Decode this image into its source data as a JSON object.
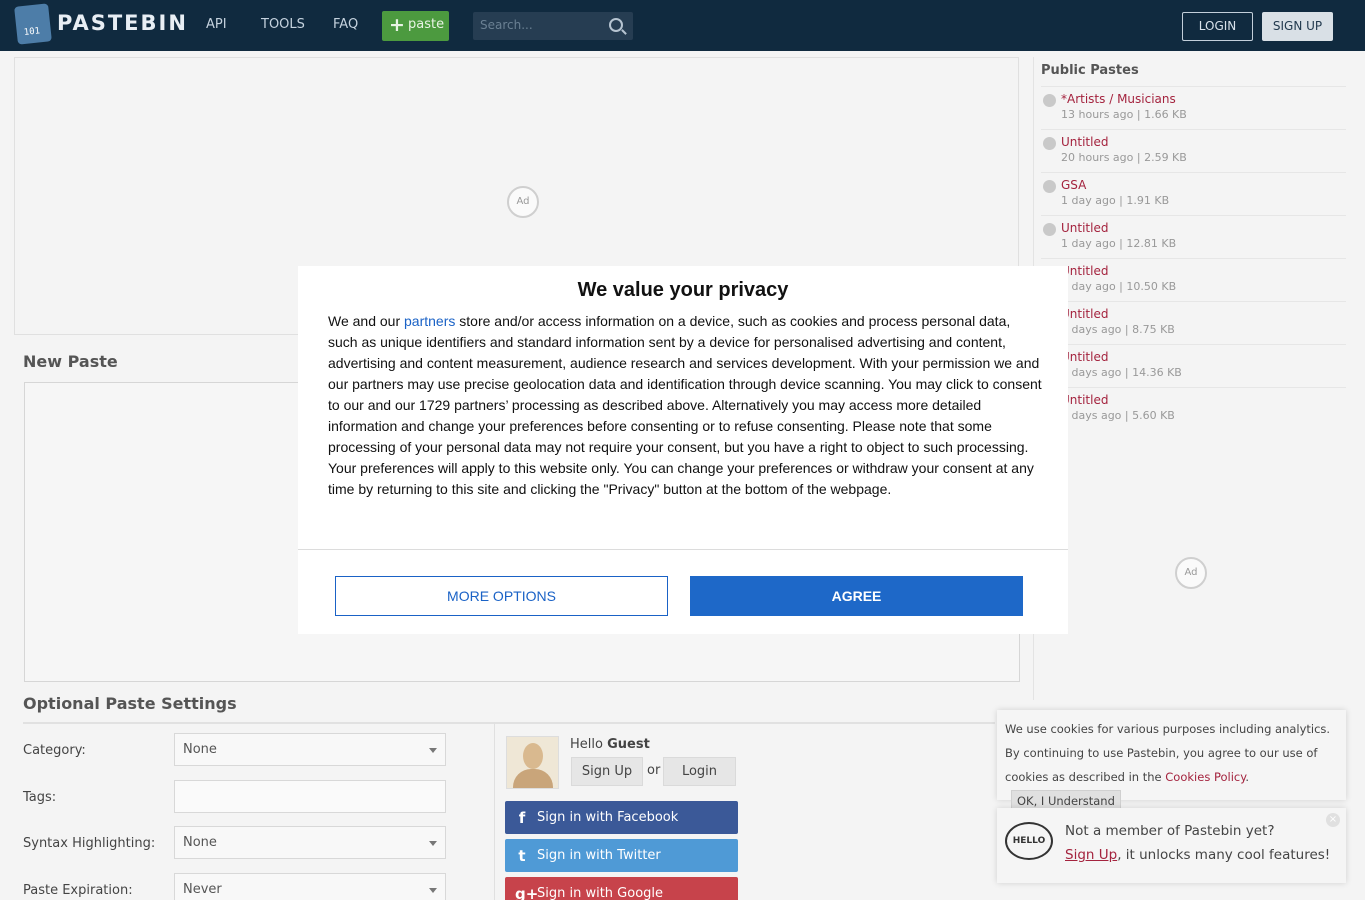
{
  "header": {
    "logo_glyph": "101",
    "brand": "PASTEBIN",
    "nav": [
      "API",
      "TOOLS",
      "FAQ"
    ],
    "paste_button": "paste",
    "search_placeholder": "Search...",
    "login": "LOGIN",
    "signup": "SIGN UP",
    "colors": {
      "bar": "#102a3f",
      "paste_green": "#4c9a3f"
    }
  },
  "ads": {
    "label": "Ad"
  },
  "new_paste": {
    "title": "New Paste"
  },
  "settings": {
    "title": "Optional Paste Settings",
    "fields": [
      {
        "label": "Category:",
        "value": "None",
        "type": "select"
      },
      {
        "label": "Tags:",
        "value": "",
        "type": "text"
      },
      {
        "label": "Syntax Highlighting:",
        "value": "None",
        "type": "select"
      },
      {
        "label": "Paste Expiration:",
        "value": "Never",
        "type": "select"
      }
    ]
  },
  "guest": {
    "hello": "Hello",
    "name": "Guest",
    "sign_up": "Sign Up",
    "or": "or",
    "login": "Login",
    "social": [
      {
        "label": "Sign in with Facebook",
        "icon": "facebook-icon",
        "glyph": "f",
        "color": "#3b5998"
      },
      {
        "label": "Sign in with Twitter",
        "icon": "twitter-icon",
        "glyph": "t",
        "color": "#4f9ad6"
      },
      {
        "label": "Sign in with Google",
        "icon": "google-plus-icon",
        "glyph": "g+",
        "color": "#c7434b"
      }
    ]
  },
  "sidebar": {
    "title": "Public Pastes",
    "items": [
      {
        "title": "*Artists / Musicians",
        "meta": "13 hours ago | 1.66 KB"
      },
      {
        "title": "Untitled",
        "meta": "20 hours ago | 2.59 KB"
      },
      {
        "title": "GSA",
        "meta": "1 day ago | 1.91 KB"
      },
      {
        "title": "Untitled",
        "meta": "1 day ago | 12.81 KB"
      },
      {
        "title": "Untitled",
        "meta": "1 day ago | 10.50 KB"
      },
      {
        "title": "Untitled",
        "meta": "2 days ago | 8.75 KB"
      },
      {
        "title": "Untitled",
        "meta": "2 days ago | 14.36 KB"
      },
      {
        "title": "Untitled",
        "meta": "2 days ago | 5.60 KB"
      }
    ]
  },
  "cookie": {
    "text": "We use cookies for various purposes including analytics. By continuing to use Pastebin, you agree to our use of cookies as described in the",
    "link": "Cookies Policy",
    "suffix": ".",
    "button": "OK, I Understand"
  },
  "member": {
    "bubble": "HELLO",
    "question": "Not a member of Pastebin yet?",
    "signup_link": "Sign Up",
    "rest": ", it unlocks many cool features!",
    "close": "×"
  },
  "consent": {
    "title": "We value your privacy",
    "body_prefix": "We and our ",
    "partners_link": "partners",
    "body_rest": " store and/or access information on a device, such as cookies and process personal data, such as unique identifiers and standard information sent by a device for personalised advertising and content, advertising and content measurement, audience research and services development. With your permission we and our partners may use precise geolocation data and identification through device scanning. You may click to consent to our and our 1729 partners’ processing as described above. Alternatively you may access more detailed information and change your preferences before consenting or to refuse consenting. Please note that some processing of your personal data may not require your consent, but you have a right to object to such processing. Your preferences will apply to this website only. You can change your preferences or withdraw your consent at any time by returning to this site and clicking the \"Privacy\" button at the bottom of the webpage.",
    "more_options": "MORE OPTIONS",
    "agree": "AGREE",
    "colors": {
      "accent": "#1e68c8"
    }
  }
}
